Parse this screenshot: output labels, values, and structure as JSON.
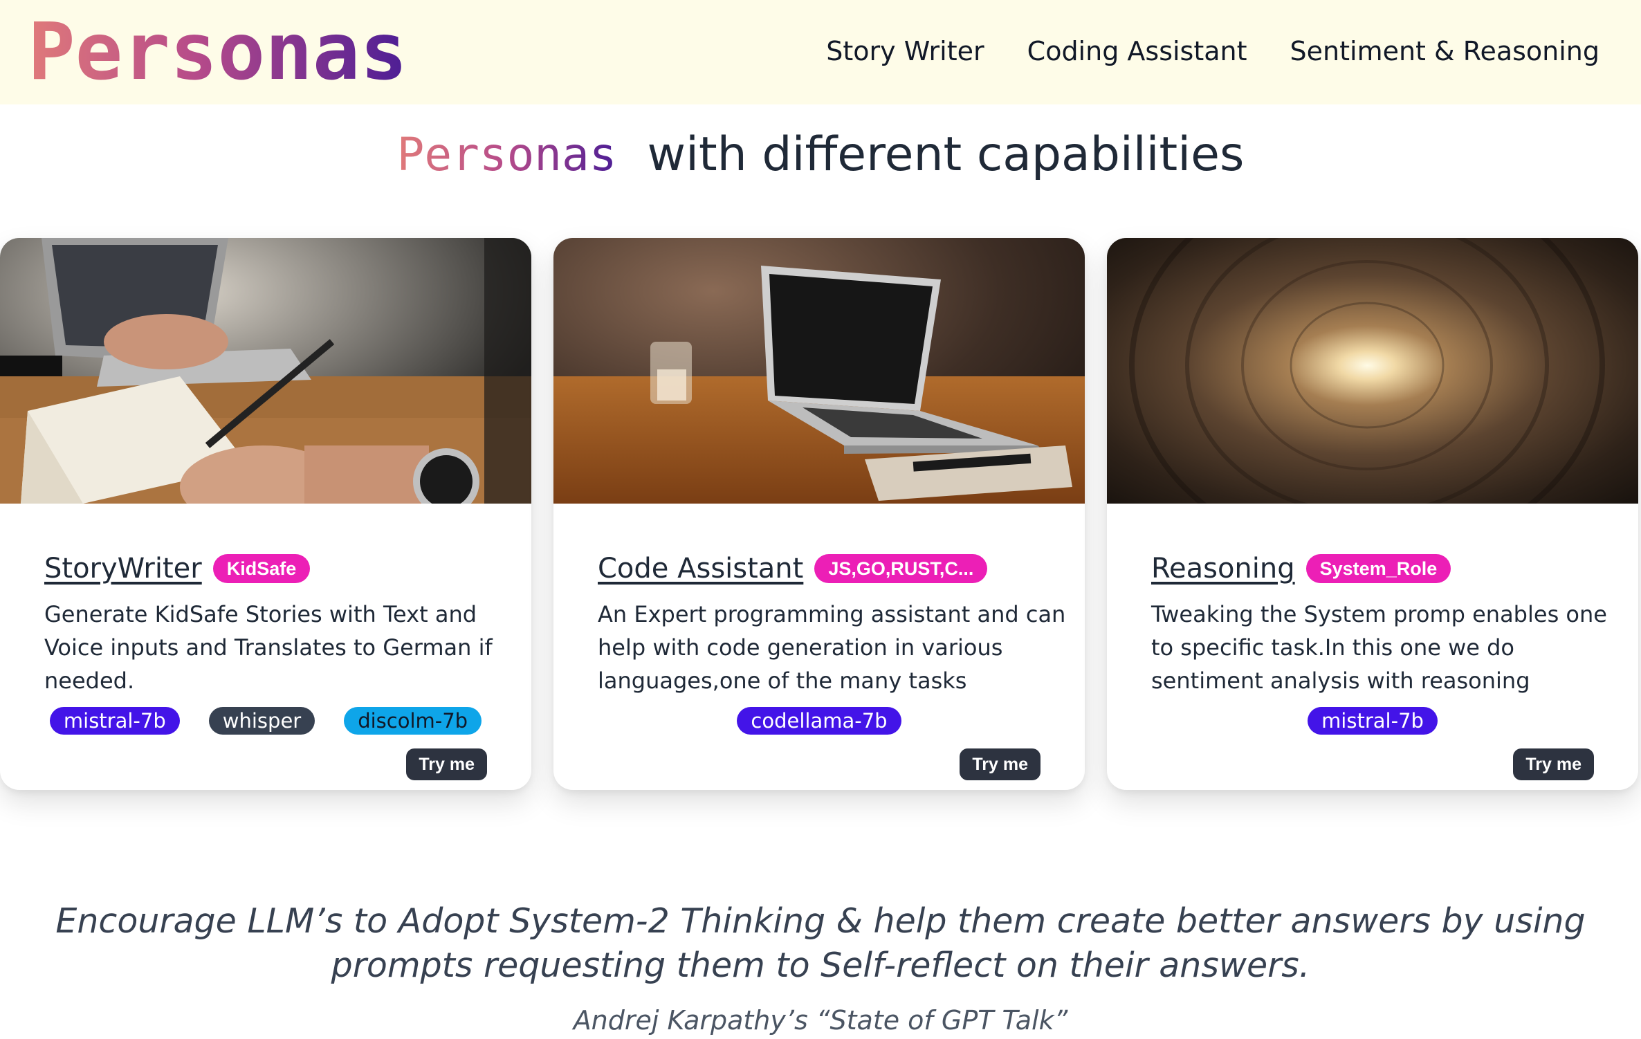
{
  "nav": {
    "brand": "Personas",
    "links": [
      "Story Writer",
      "Coding Assistant",
      "Sentiment & Reasoning"
    ]
  },
  "hero": {
    "brand": "Personas",
    "title": "with different capabilities"
  },
  "cards": [
    {
      "title": "StoryWriter",
      "badge": "KidSafe",
      "description": "Generate KidSafe Stories with Text and Voice inputs and Translates to German if needed.",
      "tags": [
        "mistral-7b",
        "whisper",
        "discolm-7b"
      ],
      "button": "Try me"
    },
    {
      "title": "Code Assistant",
      "badge": "JS,GO,RUST,C...",
      "description": "An Expert programming assistant and can help with code generation in various languages,one of the many tasks",
      "tags": [
        "codellama-7b"
      ],
      "button": "Try me"
    },
    {
      "title": "Reasoning",
      "badge": "System_Role",
      "description": "Tweaking the System promp enables one to specific task.In this one we do sentiment analysis with reasoning",
      "tags": [
        "mistral-7b"
      ],
      "button": "Try me"
    }
  ],
  "quote": {
    "line1": "Encourage LLM’s to Adopt System-2 Thinking & help them create better answers by using",
    "line2": "prompts requesting them to Self-reflect on their answers.",
    "attribution": "Andrej Karpathy’s “State of GPT Talk”"
  },
  "colors": {
    "navbar_bg": "#fefce8",
    "badge": "#ec1fb6",
    "tag_violet": "#4314e8",
    "tag_dark": "#374151",
    "tag_sky": "#0ea5e9",
    "button": "#2d3340"
  }
}
